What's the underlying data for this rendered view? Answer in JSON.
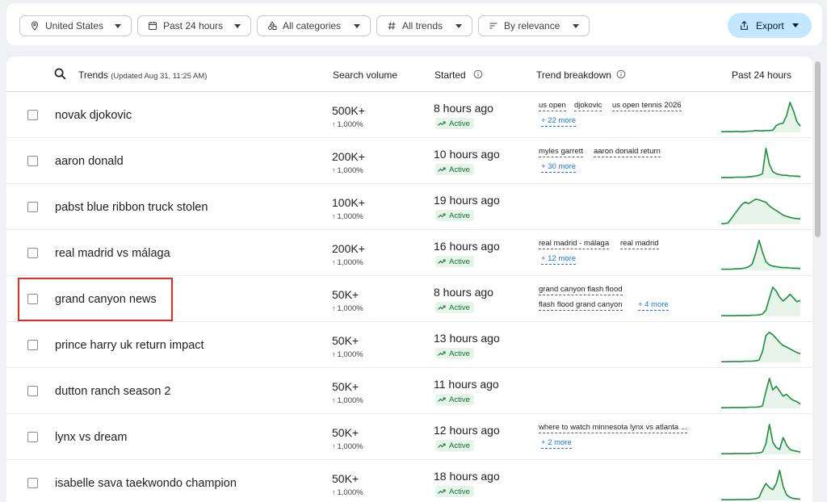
{
  "filters": {
    "location": "United States",
    "time": "Past 24 hours",
    "category": "All categories",
    "trends": "All trends",
    "sort": "By relevance",
    "export": "Export"
  },
  "table": {
    "headers": {
      "trends": "Trends",
      "updated": "(Updated Aug 31, 11:25 AM)",
      "search_volume": "Search volume",
      "started": "Started",
      "breakdown": "Trend breakdown",
      "past24": "Past 24 hours"
    },
    "rows": [
      {
        "name": "novak djokovic",
        "volume": "500K+",
        "pct": "1,000%",
        "started": "8 hours ago",
        "status": "Active",
        "breakdown": [
          "us open",
          "djokovic",
          "us open tennis 2026"
        ],
        "more": "+ 22 more"
      },
      {
        "name": "aaron donald",
        "volume": "200K+",
        "pct": "1,000%",
        "started": "10 hours ago",
        "status": "Active",
        "breakdown": [
          "myles garrett",
          "aaron donald return"
        ],
        "more": "+ 30 more"
      },
      {
        "name": "pabst blue ribbon truck stolen",
        "volume": "100K+",
        "pct": "1,000%",
        "started": "19 hours ago",
        "status": "Active",
        "breakdown": [],
        "more": ""
      },
      {
        "name": "real madrid vs málaga",
        "volume": "200K+",
        "pct": "1,000%",
        "started": "16 hours ago",
        "status": "Active",
        "breakdown": [
          "real madrid - málaga",
          "real madrid"
        ],
        "more": "+ 12 more"
      },
      {
        "name": "grand canyon news",
        "volume": "50K+",
        "pct": "1,000%",
        "started": "8 hours ago",
        "status": "Active",
        "breakdown": [
          "grand canyon flash flood",
          "flash flood grand canyon"
        ],
        "more": "+ 4 more"
      },
      {
        "name": "prince harry uk return impact",
        "volume": "50K+",
        "pct": "1,000%",
        "started": "13 hours ago",
        "status": "Active",
        "breakdown": [],
        "more": ""
      },
      {
        "name": "dutton ranch season 2",
        "volume": "50K+",
        "pct": "1,000%",
        "started": "11 hours ago",
        "status": "Active",
        "breakdown": [],
        "more": ""
      },
      {
        "name": "lynx vs dream",
        "volume": "50K+",
        "pct": "1,000%",
        "started": "12 hours ago",
        "status": "Active",
        "breakdown": [
          "where to watch minnesota lynx vs atlanta ..."
        ],
        "more": "+ 2 more"
      },
      {
        "name": "isabelle sava taekwondo champion",
        "volume": "50K+",
        "pct": "1,000%",
        "started": "18 hours ago",
        "status": "Active",
        "breakdown": [],
        "more": ""
      }
    ]
  },
  "sparklines": [
    [
      0.02,
      0.02,
      0.03,
      0.02,
      0.03,
      0.03,
      0.02,
      0.03,
      0.04,
      0.04,
      0.06,
      0.05,
      0.05,
      0.06,
      0.06,
      0.07,
      0.22,
      0.28,
      0.3,
      0.55,
      0.98,
      0.7,
      0.35,
      0.2
    ],
    [
      0.03,
      0.03,
      0.03,
      0.03,
      0.04,
      0.04,
      0.04,
      0.04,
      0.05,
      0.06,
      0.08,
      0.1,
      0.15,
      0.98,
      0.45,
      0.22,
      0.15,
      0.12,
      0.1,
      0.1,
      0.08,
      0.08,
      0.07,
      0.06
    ],
    [
      0.02,
      0.03,
      0.05,
      0.2,
      0.35,
      0.5,
      0.65,
      0.72,
      0.68,
      0.75,
      0.82,
      0.8,
      0.76,
      0.72,
      0.6,
      0.52,
      0.45,
      0.38,
      0.3,
      0.26,
      0.23,
      0.2,
      0.19,
      0.18
    ],
    [
      0.04,
      0.04,
      0.04,
      0.04,
      0.05,
      0.05,
      0.06,
      0.08,
      0.12,
      0.2,
      0.55,
      0.98,
      0.6,
      0.28,
      0.18,
      0.14,
      0.12,
      0.1,
      0.09,
      0.09,
      0.08,
      0.07,
      0.07,
      0.06
    ],
    [
      0.02,
      0.02,
      0.02,
      0.02,
      0.02,
      0.03,
      0.03,
      0.03,
      0.03,
      0.04,
      0.04,
      0.05,
      0.08,
      0.2,
      0.6,
      0.95,
      0.82,
      0.62,
      0.5,
      0.6,
      0.72,
      0.6,
      0.48,
      0.52
    ],
    [
      0.02,
      0.02,
      0.02,
      0.03,
      0.03,
      0.03,
      0.03,
      0.04,
      0.04,
      0.04,
      0.05,
      0.08,
      0.35,
      0.88,
      0.98,
      0.9,
      0.78,
      0.65,
      0.55,
      0.5,
      0.44,
      0.38,
      0.32,
      0.28
    ],
    [
      0.02,
      0.02,
      0.02,
      0.03,
      0.03,
      0.03,
      0.03,
      0.03,
      0.04,
      0.04,
      0.04,
      0.05,
      0.08,
      0.55,
      0.98,
      0.6,
      0.72,
      0.56,
      0.4,
      0.46,
      0.34,
      0.26,
      0.22,
      0.14
    ],
    [
      0.02,
      0.02,
      0.02,
      0.02,
      0.03,
      0.03,
      0.03,
      0.03,
      0.03,
      0.04,
      0.04,
      0.05,
      0.08,
      0.35,
      0.98,
      0.4,
      0.22,
      0.16,
      0.55,
      0.3,
      0.16,
      0.12,
      0.1,
      0.08
    ],
    [
      0.02,
      0.02,
      0.02,
      0.02,
      0.02,
      0.03,
      0.03,
      0.03,
      0.03,
      0.04,
      0.05,
      0.1,
      0.35,
      0.55,
      0.42,
      0.35,
      0.55,
      0.98,
      0.45,
      0.18,
      0.1,
      0.06,
      0.05,
      0.04
    ]
  ],
  "colors": {
    "spark_line": "#1e8e3e",
    "spark_fill": "#e6f4ea",
    "highlight": "#d93025",
    "export_bg": "#c2e7ff"
  }
}
